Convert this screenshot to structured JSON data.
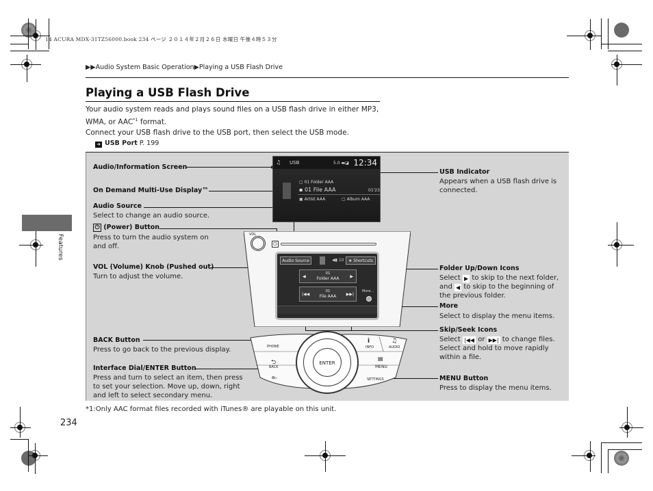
{
  "print_header": "14 ACURA MDX-31TZ56000.book  234 ページ  ２０１４年２月２６日  水曜日  午後４時５３分",
  "breadcrumb": {
    "prefix_icon": "double-triangle-right",
    "items": [
      "Audio System Basic Operation",
      "Playing a USB Flash Drive"
    ]
  },
  "page_title": "Playing a USB Flash Drive",
  "intro": {
    "line1": "Your audio system reads and plays sound files on a USB flash drive in either MP3,",
    "line2_before": "WMA, or AAC",
    "line2_sup": "*1",
    "line2_after": " format.",
    "line3": "Connect your USB flash drive to the USB port, then select the USB mode.",
    "xref_label": "USB Port",
    "xref_page": "P. 199"
  },
  "side_tab_label": "Features",
  "callouts_left": [
    {
      "title": "Audio/Information Screen",
      "desc": ""
    },
    {
      "title": "On Demand Multi-Use Display™",
      "desc": ""
    },
    {
      "title": "Audio Source",
      "desc": "Select to change an audio source."
    },
    {
      "title": "(Power) Button",
      "desc": "Press to turn the audio system on and off."
    },
    {
      "title": "VOL (Volume) Knob (Pushed out)",
      "desc": "Turn to adjust the volume."
    },
    {
      "title": "BACK Button",
      "desc": "Press to go back to the previous display."
    },
    {
      "title": "Interface Dial/ENTER Button",
      "desc": "Press and turn to select an item, then press to set your selection. Move up, down, right and left to select secondary menu."
    }
  ],
  "callouts_right": [
    {
      "title": "USB Indicator",
      "desc": "Appears when a USB flash drive is connected."
    },
    {
      "title": "Folder Up/Down Icons",
      "desc_a": "Select ",
      "icon_a": "▶",
      "desc_b": " to skip to the next folder,",
      "desc_c": "and ",
      "icon_b": "◀",
      "desc_d": " to skip to the beginning of the previous folder."
    },
    {
      "title": "More",
      "desc": "Select to display the menu items."
    },
    {
      "title": "Skip/Seek Icons",
      "desc_a": "Select ",
      "icon_a": "|◀◀",
      "desc_b": " or ",
      "icon_b": "▶▶|",
      "desc_c": " to change files.",
      "desc_d": "Select and hold to move rapidly within a file."
    },
    {
      "title": "MENU Button",
      "desc": "Press to display the menu items."
    }
  ],
  "screen": {
    "source": "USB",
    "clock": "12:34",
    "status": "5.0",
    "folder": "01  Folder AAA",
    "file": "01 File AAA",
    "time": "01'23\"",
    "artist": "Artist AAA",
    "album": "Album AAA"
  },
  "touch_panel": {
    "audio_source": "Audio Source",
    "shortcuts": "★  Shortcuts",
    "volume": "10",
    "folder_num": "01",
    "folder_name": "Folder AAA",
    "file_num": "01",
    "file_name": "File AAA",
    "more": "More..."
  },
  "head_unit": {
    "vol_label": "VOL",
    "phone": "PHONE",
    "back": "BACK",
    "enter": "ENTER",
    "info": "INFO",
    "audio": "AUDIO",
    "menu": "MENU",
    "settings": "SETTINGS"
  },
  "footnote": "*1:Only AAC format files recorded with iTunes® are playable on this unit.",
  "page_number": "234"
}
